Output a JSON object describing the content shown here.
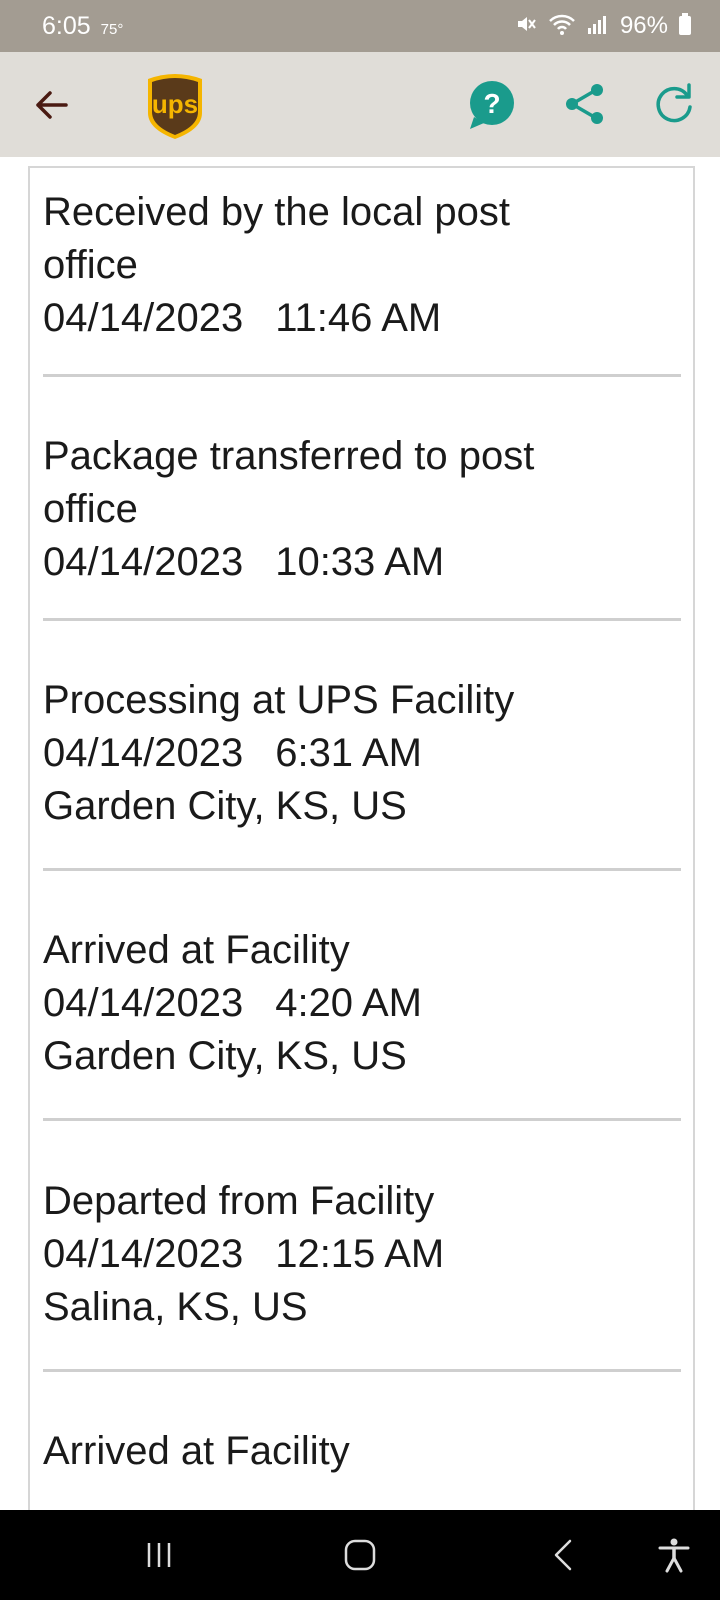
{
  "status_bar": {
    "time": "6:05",
    "temperature": "75°",
    "battery": "96%"
  },
  "app_bar": {
    "logo_text": "ups",
    "accent_color": "#1a9b8c",
    "brand_brown": "#5a3a1a",
    "brand_gold": "#f5b500"
  },
  "events": [
    {
      "status_lines": [
        "Received by the local post",
        "office"
      ],
      "date": "04/14/2023",
      "time": "11:46 AM",
      "location": ""
    },
    {
      "status_lines": [
        "Package transferred to post",
        "office"
      ],
      "date": "04/14/2023",
      "time": "10:33 AM",
      "location": ""
    },
    {
      "status_lines": [
        "Processing at UPS Facility"
      ],
      "date": "04/14/2023",
      "time": "6:31 AM",
      "location": "Garden City, KS, US"
    },
    {
      "status_lines": [
        "Arrived at Facility"
      ],
      "date": "04/14/2023",
      "time": "4:20 AM",
      "location": "Garden City, KS, US"
    },
    {
      "status_lines": [
        "Departed from Facility"
      ],
      "date": "04/14/2023",
      "time": "12:15 AM",
      "location": "Salina, KS, US"
    },
    {
      "status_lines": [
        "Arrived at Facility"
      ],
      "date": "",
      "time": "",
      "location": ""
    }
  ],
  "nav_bar": {
    "icons": [
      "recent-apps-icon",
      "home-icon",
      "back-icon",
      "accessibility-icon"
    ]
  }
}
